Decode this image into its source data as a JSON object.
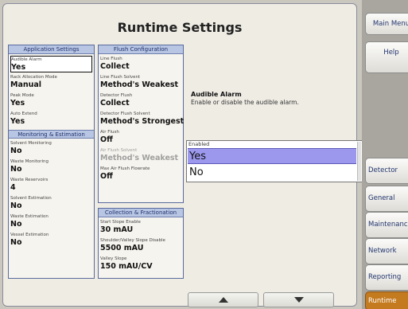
{
  "title": "Runtime Settings",
  "application_settings": {
    "header": "Application Settings",
    "fields": [
      {
        "label": "Audible Alarm",
        "value": "Yes"
      },
      {
        "label": "Rack Allocation Mode",
        "value": "Manual"
      },
      {
        "label": "Peak Mode",
        "value": "Yes"
      },
      {
        "label": "Auto Extend",
        "value": "Yes"
      }
    ]
  },
  "monitoring_estimation": {
    "header": "Monitoring & Estimation",
    "fields": [
      {
        "label": "Solvent Monitoring",
        "value": "No"
      },
      {
        "label": "Waste Monitoring",
        "value": "No"
      },
      {
        "label": "Waste Reservoirs",
        "value": "4"
      },
      {
        "label": "Solvent Estimation",
        "value": "No"
      },
      {
        "label": "Waste Estimation",
        "value": "No"
      },
      {
        "label": "Vessel Estimation",
        "value": "No"
      }
    ]
  },
  "flush_configuration": {
    "header": "Flush Configuration",
    "fields": [
      {
        "label": "Line Flush",
        "value": "Collect"
      },
      {
        "label": "Line Flush Solvent",
        "value": "Method's Weakest"
      },
      {
        "label": "Detector Flush",
        "value": "Collect"
      },
      {
        "label": "Detector Flush Solvent",
        "value": "Method's Strongest"
      },
      {
        "label": "Air Flush",
        "value": "Off"
      },
      {
        "label": "Air Flush Solvent",
        "value": "Method's Weakest"
      },
      {
        "label": "Max Air Flush Flowrate",
        "value": "Off"
      }
    ]
  },
  "collection_fractionation": {
    "header": "Collection & Fractionation",
    "fields": [
      {
        "label": "Start Slope Enable",
        "value": "30 mAU"
      },
      {
        "label": "Shoulder/Valley Slope Disable",
        "value": "5500 mAU"
      },
      {
        "label": "Valley Slope",
        "value": "150 mAU/CV"
      }
    ]
  },
  "description": {
    "title": "Audible Alarm",
    "text": "Enable or disable the audible alarm."
  },
  "options": {
    "header": "Enabled",
    "items": [
      "Yes",
      "No"
    ],
    "selected": "Yes"
  },
  "scroll_buttons": {
    "up": "up-arrow-icon",
    "down": "down-arrow-icon"
  },
  "side_menu": {
    "top": [
      "Main Menu",
      "Help"
    ],
    "nav": [
      "Detector",
      "General",
      "Maintenance",
      "Network",
      "Reporting",
      "Runtime"
    ],
    "active": "Runtime"
  },
  "colors": {
    "panel_header": "#b8c6e4",
    "selection": "#9c98ee",
    "active_tab": "#c47a1e",
    "menu_text": "#23356f"
  }
}
